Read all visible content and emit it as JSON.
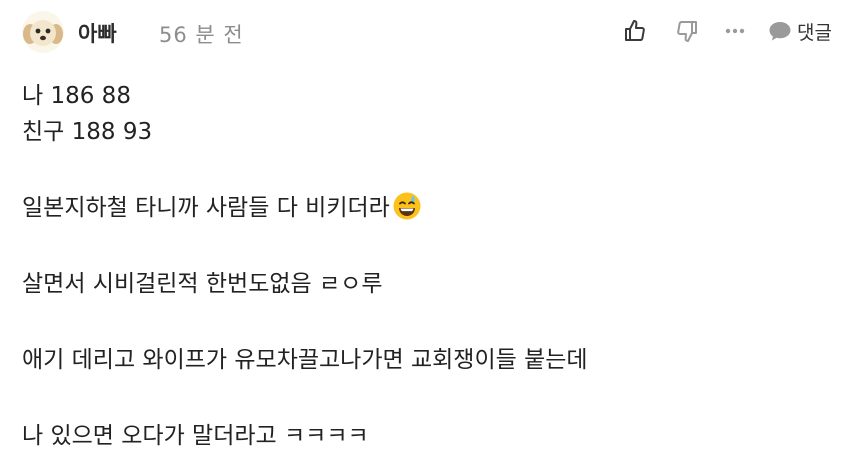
{
  "comment": {
    "author": "아빠",
    "time": "56 분 전",
    "actions": {
      "like_icon": "thumbs-up-icon",
      "dislike_icon": "thumbs-down-icon",
      "more_icon": "ellipsis-icon",
      "reply_icon": "speech-bubble-icon",
      "reply_label": "댓글"
    },
    "body": {
      "line1": "나 186 88",
      "line2": "친구 188 93",
      "line3": "일본지하철 타니까 사람들 다 비키더라",
      "line3_emoji": "grinning-sweat-emoji",
      "line4": "살면서 시비걸린적 한번도없음 ㄹㅇ루",
      "line5": "애기 데리고 와이프가 유모차끌고나가면 교회쟁이들 붙는데",
      "line6": "나 있으면 오다가 말더라고 ㅋㅋㅋㅋ"
    }
  },
  "colors": {
    "text": "#222222",
    "muted": "#8d8d8d",
    "icon": "#3a3a3a",
    "icon_muted": "#9a9a9a"
  }
}
